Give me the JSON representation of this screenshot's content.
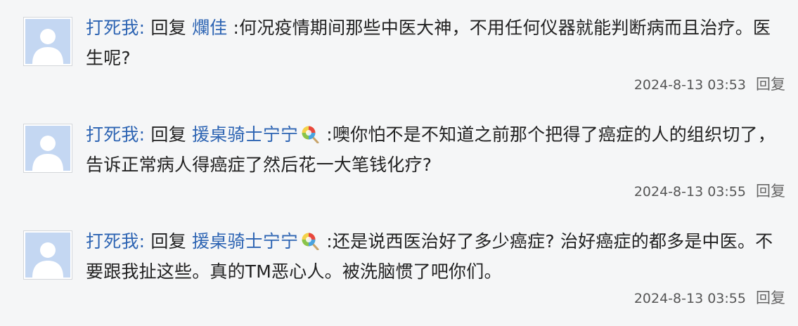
{
  "replies": [
    {
      "author": "打死我:",
      "reply_word": "回复",
      "target": "爛佳",
      "has_emoji": false,
      "text": " :何况疫情期间那些中医大神，不用任何仪器就能判断病而且治疗。医生呢?",
      "timestamp": "2024-8-13 03:53",
      "reply_link": "回复"
    },
    {
      "author": "打死我:",
      "reply_word": "回复",
      "target": "援桌骑士宁宁",
      "has_emoji": true,
      "emoji_icon": "lollipop-icon",
      "text": " :噢你怕不是不知道之前那个把得了癌症的人的组织切了，告诉正常病人得癌症了然后花一大笔钱化疗?",
      "timestamp": "2024-8-13 03:55",
      "reply_link": "回复"
    },
    {
      "author": "打死我:",
      "reply_word": "回复",
      "target": "援桌骑士宁宁",
      "has_emoji": true,
      "emoji_icon": "lollipop-icon",
      "text": " :还是说西医治好了多少癌症? 治好癌症的都多是中医。不要跟我扯这些。真的TM恶心人。被洗脑惯了吧你们。",
      "timestamp": "2024-8-13 03:55",
      "reply_link": "回复"
    }
  ],
  "colors": {
    "background": "#f5f6f7",
    "link": "#2d64b3",
    "text": "#222222",
    "meta": "#555555"
  }
}
